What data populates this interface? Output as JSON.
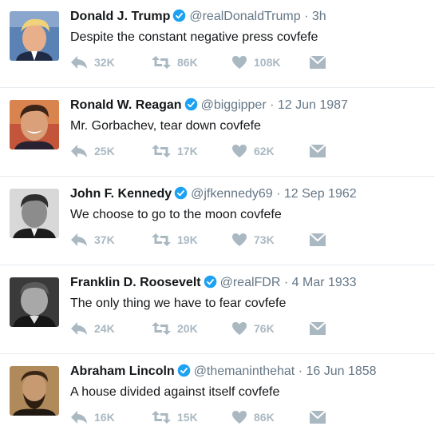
{
  "colors": {
    "verified": "#1da1f2",
    "action_icon": "#aab8c2",
    "handle_text": "#657786"
  },
  "tweets": [
    {
      "name": "Donald J. Trump",
      "handle": "@realDonaldTrump",
      "separator": "·",
      "time": "3h",
      "text": "Despite the constant negative press covfefe",
      "replies": "32K",
      "retweets": "86K",
      "likes": "108K",
      "avatar_icon": "profile-photo"
    },
    {
      "name": "Ronald W. Reagan",
      "handle": "@biggipper",
      "separator": "·",
      "time": "12 Jun 1987",
      "text": "Mr. Gorbachev, tear down covfefe",
      "replies": "25K",
      "retweets": "17K",
      "likes": "62K",
      "avatar_icon": "profile-photo"
    },
    {
      "name": "John F. Kennedy",
      "handle": "@jfkennedy69",
      "separator": "·",
      "time": "12 Sep 1962",
      "text": "We choose to go to the moon covfefe",
      "replies": "37K",
      "retweets": "19K",
      "likes": "73K",
      "avatar_icon": "profile-photo"
    },
    {
      "name": "Franklin D. Roosevelt",
      "handle": "@realFDR",
      "separator": "·",
      "time": "4 Mar 1933",
      "text": "The only thing we have to fear covfefe",
      "replies": "24K",
      "retweets": "20K",
      "likes": "76K",
      "avatar_icon": "profile-photo"
    },
    {
      "name": "Abraham Lincoln",
      "handle": "@themaninthehat",
      "separator": "·",
      "time": "16 Jun 1858",
      "text": "A house divided against itself covfefe",
      "replies": "16K",
      "retweets": "15K",
      "likes": "86K",
      "avatar_icon": "profile-photo"
    }
  ]
}
